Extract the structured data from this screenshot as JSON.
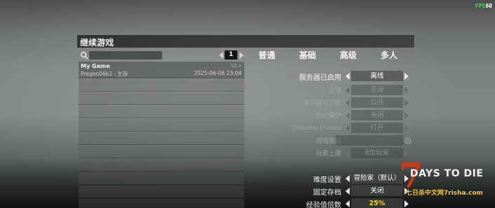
{
  "overlay": {
    "fps_green": "FPS",
    "fps_suffix": "60"
  },
  "panel": {
    "title": "继续游戏"
  },
  "save_list": {
    "search_placeholder": "",
    "page_number": "1",
    "saves": [
      {
        "name": "My Game",
        "version": "V2.x",
        "meta": "Pregen06k2 - 生存",
        "date": "2025-06-06 23:04"
      }
    ]
  },
  "tabs": [
    {
      "label": "普通"
    },
    {
      "label": "基础"
    },
    {
      "label": "高级"
    },
    {
      "label": "多人"
    }
  ],
  "settings": [
    {
      "label": "服务器已启用",
      "value": "离线"
    },
    {
      "label": "区域",
      "value": "亚洲"
    },
    {
      "label": "服务器可见性",
      "value": "公开"
    },
    {
      "label": "EAC保护",
      "value": "关闭"
    },
    {
      "label": "Crossplay Enabled",
      "value": "打开"
    },
    {
      "label": "游戏密码",
      "value": ""
    },
    {
      "label": "玩家上限",
      "value": "8位玩家"
    },
    {
      "label": "难度设置",
      "value": "冒险家（默认）"
    },
    {
      "label": "固定存档",
      "value": "关闭"
    },
    {
      "label": "经验值倍数",
      "value": "25%"
    }
  ],
  "logo": {
    "seven": "7",
    "title": "DAYS TO DIE",
    "watermark": "七日杀中文网7risha.com"
  },
  "icons": {
    "search": "search-icon",
    "eye": "eye-icon"
  },
  "colors": {
    "accent_yellow": "#ffd21e",
    "logo_red": "#c43a1e",
    "fps_green": "#38e238"
  }
}
